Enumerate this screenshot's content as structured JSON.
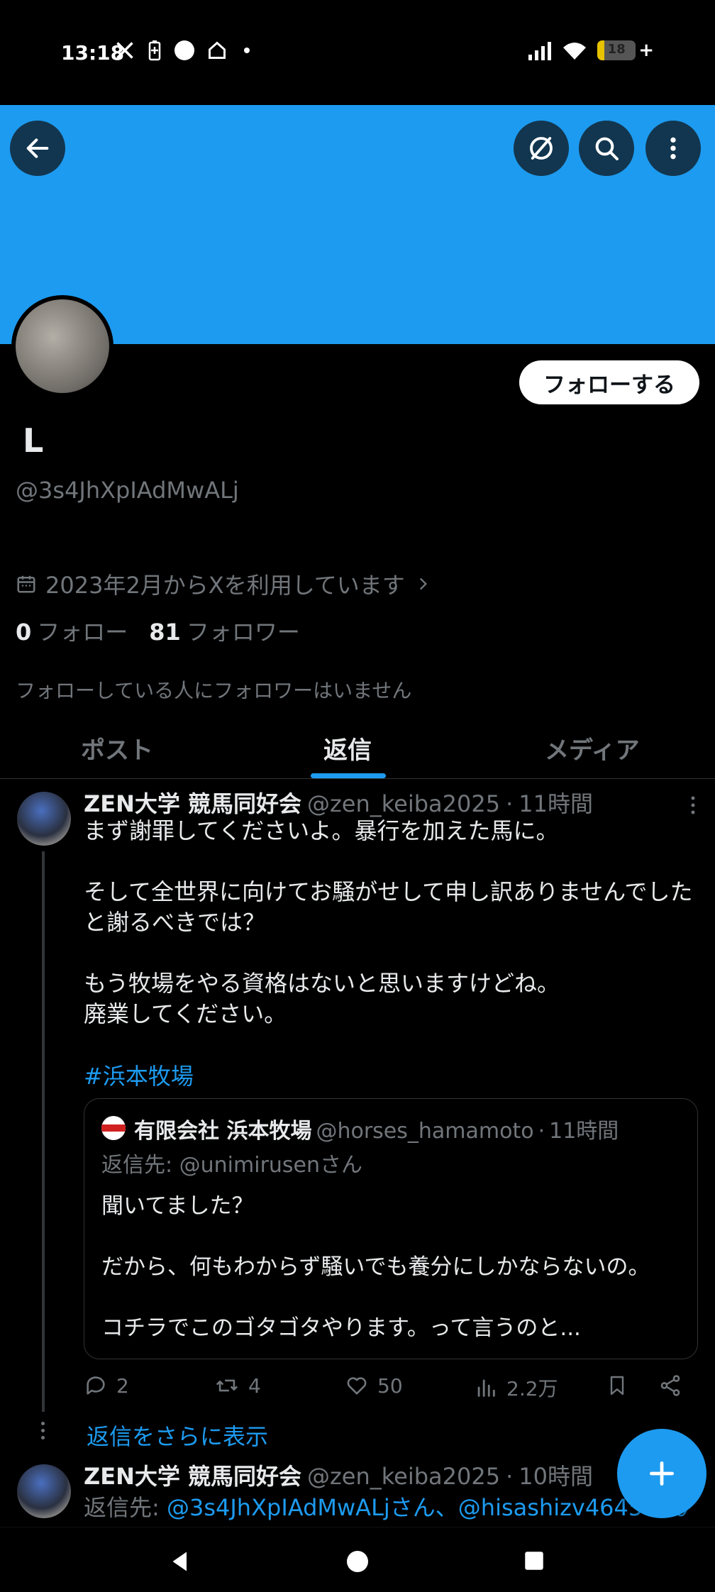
{
  "status_bar": {
    "time": "13:18",
    "battery": "18",
    "battery_level": 0.18,
    "icons_left": [
      "x-icon",
      "battery-saver-icon",
      "circle-icon",
      "home-icon",
      "dot-icon"
    ],
    "icons_right": [
      "signal-icon",
      "wifi-icon",
      "battery-icon"
    ]
  },
  "colors": {
    "accent": "#1d9bf0",
    "banner": "#1d9bf0",
    "background": "#000000",
    "muted": "#71767b"
  },
  "profile": {
    "follow_label": "フォローする",
    "display_name": "L",
    "handle": "@3s4JhXpIAdMwALj",
    "joined": "2023年2月からXを利用しています",
    "following_count": "0",
    "following_label": "フォロー",
    "followers_count": "81",
    "followers_label": "フォロワー",
    "no_followers_note": "フォローしている人にフォロワーはいません"
  },
  "tabs": [
    {
      "label": "ポスト",
      "active": false
    },
    {
      "label": "返信",
      "active": true
    },
    {
      "label": "メディア",
      "active": false
    }
  ],
  "posts": [
    {
      "author_name": "ZEN大学 競馬同好会",
      "author_handle": "@zen_keiba2025",
      "time": "11時間",
      "body": "まず謝罪してくださいよ。暴行を加えた馬に。\n\nそして全世界に向けてお騒がせして申し訳ありませんでしたと謝るべきでは？\n\nもう牧場をやる資格はないと思いますけどね。\n廃業してください。",
      "hashtag": "#浜本牧場",
      "quote": {
        "author_name": "有限会社 浜本牧場",
        "author_handle": "@horses_hamamoto",
        "time": "11時間",
        "reply_to": "返信先: @unimirusenさん",
        "body": "聞いてました？\n\nだから、何もわからず騒いでも養分にしかならないの。\n\nコチラでこのゴタゴタやります。って言うのと..."
      },
      "stats": {
        "replies": "2",
        "reposts": "4",
        "likes": "50",
        "views": "2.2万"
      }
    },
    {
      "author_name": "ZEN大学 競馬同好会",
      "author_handle": "@zen_keiba2025",
      "time": "10時間",
      "reply_prefix": "返信先: ",
      "reply_targets": "@3s4JhXpIAdMwALjさん、@hisashizv4645さん"
    }
  ],
  "show_more_replies": "返信をさらに表示"
}
